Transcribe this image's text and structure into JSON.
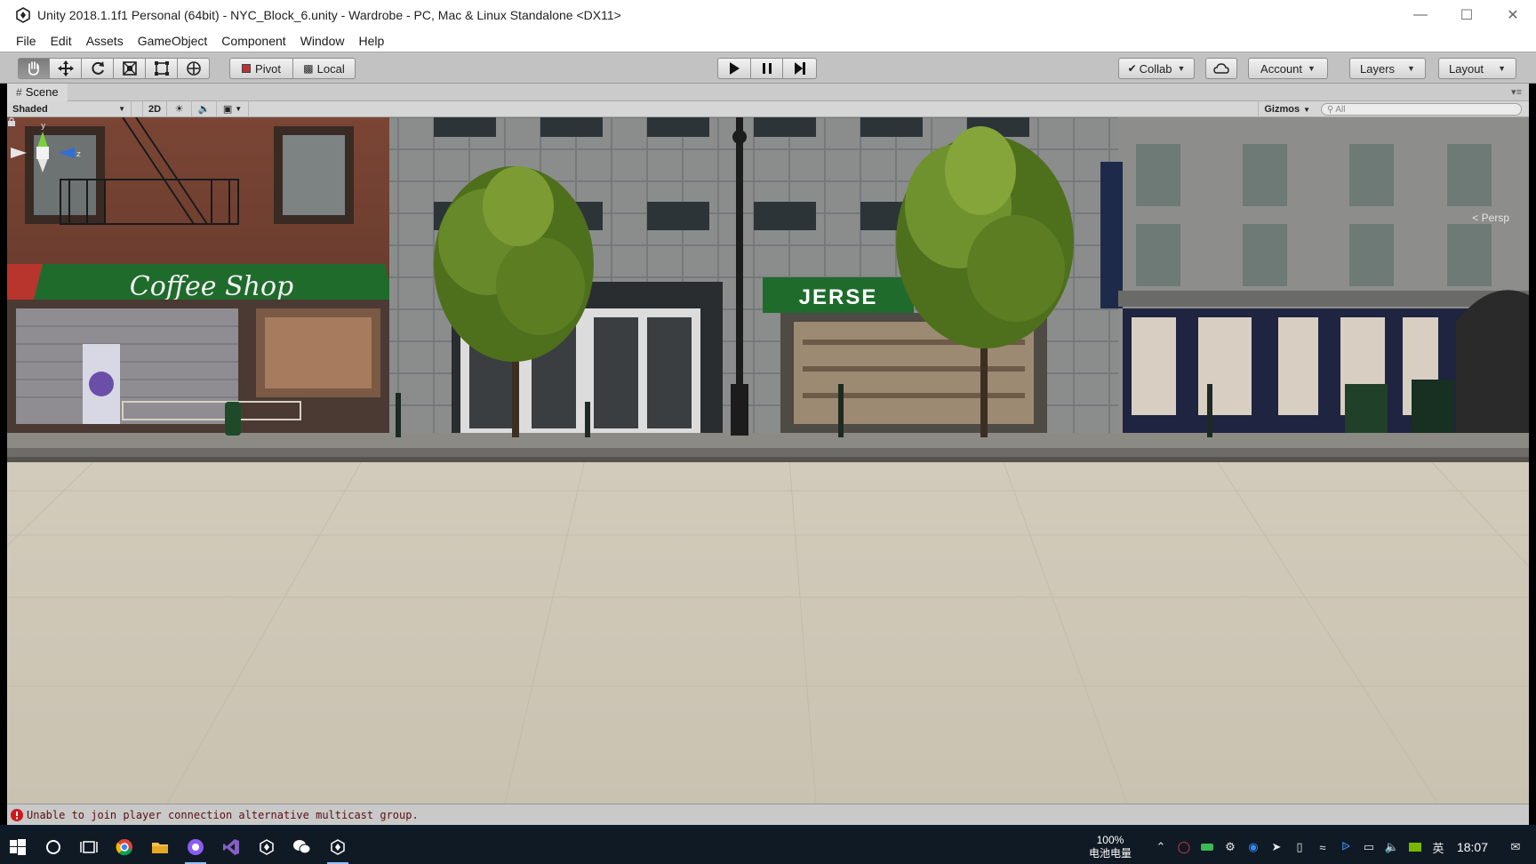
{
  "window": {
    "title": "Unity 2018.1.1f1 Personal (64bit) - NYC_Block_6.unity - Wardrobe - PC, Mac & Linux Standalone <DX11>",
    "controls": [
      "minimize-icon",
      "maximize-icon",
      "close-icon"
    ]
  },
  "menu": [
    "File",
    "Edit",
    "Assets",
    "GameObject",
    "Component",
    "Window",
    "Help"
  ],
  "toolbar": {
    "tools": [
      "hand-tool-icon",
      "move-tool-icon",
      "rotate-tool-icon",
      "scale-tool-icon",
      "rect-tool-icon",
      "transform-tool-icon"
    ],
    "selected_tool": "hand-tool-icon",
    "pivot_label": "Pivot",
    "local_label": "Local",
    "collab_label": "Collab",
    "account_label": "Account",
    "layers_label": "Layers",
    "layout_label": "Layout"
  },
  "scene": {
    "tab_label": "Scene",
    "shading_mode": "Shaded",
    "toggle_2d": "2D",
    "gizmos_label": "Gizmos",
    "search_placeholder": "All",
    "projection_label": "Persp",
    "axis_labels": {
      "y": "y",
      "z": "z"
    },
    "storefront_signs": {
      "coffee": "Coffee Shop",
      "jersey": "JERSE"
    }
  },
  "status": {
    "message": "Unable to join player connection alternative multicast group.",
    "level": "error"
  },
  "taskbar": {
    "apps": [
      "windows-start-icon",
      "cortana-icon",
      "task-view-icon",
      "chrome-icon",
      "file-explorer-icon",
      "media-player-icon",
      "visual-studio-icon",
      "unity-icon",
      "wechat-icon",
      "unity-active-icon"
    ],
    "battery_percent": "100%",
    "battery_label": "电池电量",
    "ime_label": "英",
    "clock": "18:07"
  },
  "colors": {
    "toolbar_bg": "#c2c2c2",
    "taskbar_bg": "#101a24",
    "awning_green": "#1f6b2c",
    "error_red": "#d01818"
  }
}
